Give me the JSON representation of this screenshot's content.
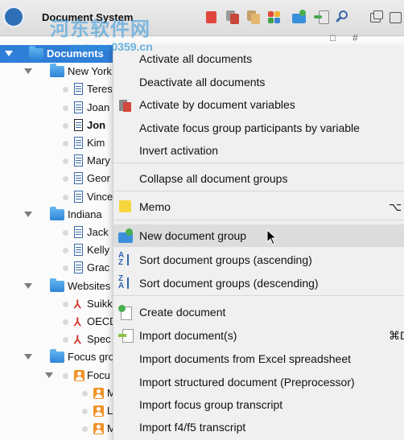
{
  "window": {
    "title": "Document System",
    "watermark": "河东软件网",
    "watermark_url": "www.pc0359.cn"
  },
  "column_headers": [
    "□",
    "#"
  ],
  "tree": {
    "root": "Documents",
    "rows": [
      {
        "label": "New York",
        "kind": "group"
      },
      {
        "label": "Teres",
        "kind": "doc"
      },
      {
        "label": "Joan",
        "kind": "doc"
      },
      {
        "label": "Jon",
        "kind": "doc-edit"
      },
      {
        "label": "Kim",
        "kind": "doc"
      },
      {
        "label": "Mary",
        "kind": "doc"
      },
      {
        "label": "Geor",
        "kind": "doc"
      },
      {
        "label": "Vince",
        "kind": "doc"
      },
      {
        "label": "Indiana",
        "kind": "group"
      },
      {
        "label": "Jack",
        "kind": "doc"
      },
      {
        "label": "Kelly",
        "kind": "doc"
      },
      {
        "label": "Grac",
        "kind": "doc"
      },
      {
        "label": "Websites",
        "kind": "group"
      },
      {
        "label": "Suikk",
        "kind": "pdf"
      },
      {
        "label": "OECD",
        "kind": "pdf"
      },
      {
        "label": "Spec",
        "kind": "pdf"
      },
      {
        "label": "Focus gro",
        "kind": "group"
      },
      {
        "label": "Focu",
        "kind": "focus"
      },
      {
        "label": "M",
        "kind": "person"
      },
      {
        "label": "L",
        "kind": "person"
      },
      {
        "label": "M",
        "kind": "person"
      }
    ]
  },
  "context_menu": {
    "items": [
      {
        "label": "Activate all documents",
        "icon": "",
        "shortcut": ""
      },
      {
        "label": "Deactivate all documents",
        "icon": "",
        "shortcut": ""
      },
      {
        "label": "Activate by document variables",
        "icon": "activate-variables-icon",
        "shortcut": ""
      },
      {
        "label": "Activate focus group participants by variable",
        "icon": "",
        "shortcut": ""
      },
      {
        "label": "Invert activation",
        "icon": "",
        "shortcut": ""
      },
      {
        "label": "Collapse all document groups",
        "icon": "",
        "shortcut": ""
      },
      {
        "label": "Memo",
        "icon": "memo-icon",
        "shortcut": "⌥⇧"
      },
      {
        "label": "New document group",
        "icon": "new-group-icon",
        "shortcut": ""
      },
      {
        "label": "Sort document groups (ascending)",
        "icon": "sort-ascending-icon",
        "shortcut": ""
      },
      {
        "label": "Sort document groups (descending)",
        "icon": "sort-descending-icon",
        "shortcut": ""
      },
      {
        "label": "Create document",
        "icon": "create-document-icon",
        "shortcut": ""
      },
      {
        "label": "Import document(s)",
        "icon": "import-documents-icon",
        "shortcut": "⌘D"
      },
      {
        "label": "Import documents from Excel spreadsheet",
        "icon": "",
        "shortcut": ""
      },
      {
        "label": "Import structured document (Preprocessor)",
        "icon": "",
        "shortcut": ""
      },
      {
        "label": "Import focus group transcript",
        "icon": "",
        "shortcut": ""
      },
      {
        "label": "Import f4/f5 transcript",
        "icon": "",
        "shortcut": ""
      }
    ],
    "hovered": "New document group"
  },
  "colors": {
    "selection": "#2f7fd9",
    "menu_bg": "#f0f0f0",
    "hover": "#dcdcdc",
    "folder": "#3a8fdd",
    "pdf": "#d2352a",
    "person": "#f0932b"
  }
}
